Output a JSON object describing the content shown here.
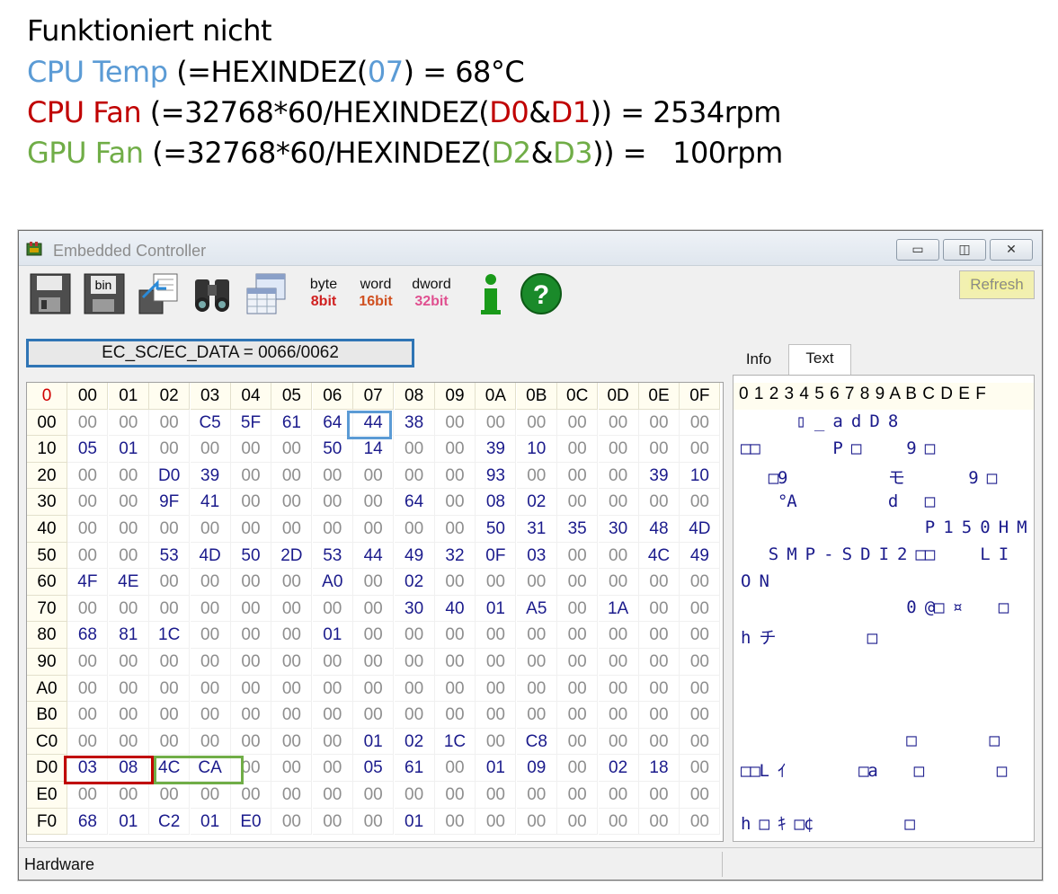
{
  "annotation": {
    "line1": "Funktioniert nicht",
    "cpu_temp": {
      "label": "CPU Temp",
      "open": " (=HEXINDEZ(",
      "arg": "07",
      "close": ") = 68°C"
    },
    "cpu_fan": {
      "label": "CPU Fan",
      "open": " (=32768*60/HEXINDEZ(",
      "a": "D0",
      "amp": "&",
      "b": "D1",
      "close": ")) = 2534rpm"
    },
    "gpu_fan": {
      "label": "GPU Fan",
      "open": " (=32768*60/HEXINDEZ(",
      "a": "D2",
      "amp": "&",
      "b": "D3",
      "close": ")) =   100rpm"
    }
  },
  "window": {
    "title": "Embedded Controller",
    "minimize": "▭",
    "restore": "◫",
    "close": "✕",
    "refresh_label": "Refresh"
  },
  "toolbar": {
    "buttons": [
      "save-icon",
      "save-bin-icon",
      "export-icon",
      "find-binoculars-icon",
      "table-view-icon",
      "byte-8bit",
      "word-16bit",
      "dword-32bit",
      "info-icon",
      "help-icon"
    ],
    "byte_l1": "byte",
    "byte_l2": "8bit",
    "word_l1": "word",
    "word_l2": "16bit",
    "dword_l1": "dword",
    "dword_l2": "32bit",
    "bin_label": "bin"
  },
  "ec_port": "EC_SC/EC_DATA = 0066/0062",
  "grid": {
    "corner": "0",
    "col_headers": [
      "00",
      "01",
      "02",
      "03",
      "04",
      "05",
      "06",
      "07",
      "08",
      "09",
      "0A",
      "0B",
      "0C",
      "0D",
      "0E",
      "0F"
    ],
    "row_headers": [
      "00",
      "10",
      "20",
      "30",
      "40",
      "50",
      "60",
      "70",
      "80",
      "90",
      "A0",
      "B0",
      "C0",
      "D0",
      "E0",
      "F0"
    ],
    "rows": [
      [
        "00",
        "00",
        "00",
        "C5",
        "5F",
        "61",
        "64",
        "44",
        "38",
        "00",
        "00",
        "00",
        "00",
        "00",
        "00",
        "00"
      ],
      [
        "05",
        "01",
        "00",
        "00",
        "00",
        "00",
        "50",
        "14",
        "00",
        "00",
        "39",
        "10",
        "00",
        "00",
        "00",
        "00"
      ],
      [
        "00",
        "00",
        "D0",
        "39",
        "00",
        "00",
        "00",
        "00",
        "00",
        "00",
        "93",
        "00",
        "00",
        "00",
        "39",
        "10"
      ],
      [
        "00",
        "00",
        "9F",
        "41",
        "00",
        "00",
        "00",
        "00",
        "64",
        "00",
        "08",
        "02",
        "00",
        "00",
        "00",
        "00"
      ],
      [
        "00",
        "00",
        "00",
        "00",
        "00",
        "00",
        "00",
        "00",
        "00",
        "00",
        "50",
        "31",
        "35",
        "30",
        "48",
        "4D"
      ],
      [
        "00",
        "00",
        "53",
        "4D",
        "50",
        "2D",
        "53",
        "44",
        "49",
        "32",
        "0F",
        "03",
        "00",
        "00",
        "4C",
        "49"
      ],
      [
        "4F",
        "4E",
        "00",
        "00",
        "00",
        "00",
        "A0",
        "00",
        "02",
        "00",
        "00",
        "00",
        "00",
        "00",
        "00",
        "00"
      ],
      [
        "00",
        "00",
        "00",
        "00",
        "00",
        "00",
        "00",
        "00",
        "30",
        "40",
        "01",
        "A5",
        "00",
        "1A",
        "00",
        "00"
      ],
      [
        "68",
        "81",
        "1C",
        "00",
        "00",
        "00",
        "01",
        "00",
        "00",
        "00",
        "00",
        "00",
        "00",
        "00",
        "00",
        "00"
      ],
      [
        "00",
        "00",
        "00",
        "00",
        "00",
        "00",
        "00",
        "00",
        "00",
        "00",
        "00",
        "00",
        "00",
        "00",
        "00",
        "00"
      ],
      [
        "00",
        "00",
        "00",
        "00",
        "00",
        "00",
        "00",
        "00",
        "00",
        "00",
        "00",
        "00",
        "00",
        "00",
        "00",
        "00"
      ],
      [
        "00",
        "00",
        "00",
        "00",
        "00",
        "00",
        "00",
        "00",
        "00",
        "00",
        "00",
        "00",
        "00",
        "00",
        "00",
        "00"
      ],
      [
        "00",
        "00",
        "00",
        "00",
        "00",
        "00",
        "00",
        "01",
        "02",
        "1C",
        "00",
        "C8",
        "00",
        "00",
        "00",
        "00"
      ],
      [
        "03",
        "08",
        "4C",
        "CA",
        "00",
        "00",
        "00",
        "05",
        "61",
        "00",
        "01",
        "09",
        "00",
        "02",
        "18",
        "00"
      ],
      [
        "00",
        "00",
        "00",
        "00",
        "00",
        "00",
        "00",
        "00",
        "00",
        "00",
        "00",
        "00",
        "00",
        "00",
        "00",
        "00"
      ],
      [
        "68",
        "01",
        "C2",
        "01",
        "E0",
        "00",
        "00",
        "00",
        "01",
        "00",
        "00",
        "00",
        "00",
        "00",
        "00",
        "00"
      ]
    ]
  },
  "tabs": {
    "info": "Info",
    "text": "Text"
  },
  "text_panel": {
    "header": "0 1 2 3 4 5 6 7 8 9 A B C D E F",
    "lines": [
      "      ▯ _ a d D 8",
      "□□        P □     9 □",
      "   □9           モ       9 □",
      "    °A          d   □",
      "                    P 1 5 0 H M",
      "   S M P - S D I 2 □□     L I",
      "O N",
      "                  0 @□ ¤    □",
      "h チ          □",
      "",
      "",
      "",
      "                  □        □",
      "□□L ｲ        □a    □        □",
      "",
      "h □ ｷ □¢          □"
    ]
  },
  "status": {
    "left": "Hardware"
  }
}
